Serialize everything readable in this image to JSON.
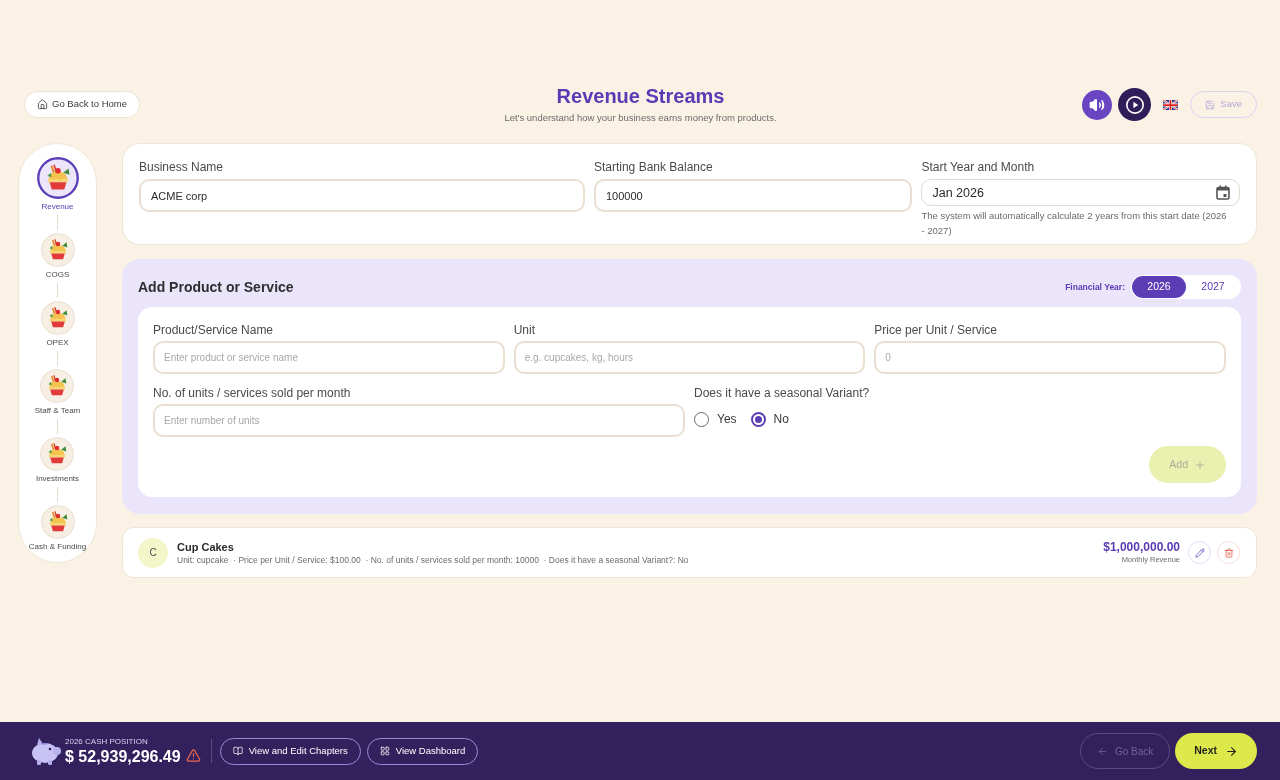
{
  "header": {
    "back_button": "Go Back to Home",
    "title": "Revenue Streams",
    "subtitle": "Let's understand how your business earns money from products.",
    "save_button": {
      "label": "Save",
      "disabled": true
    }
  },
  "steps": [
    {
      "label": "Revenue",
      "selected": true
    },
    {
      "label": "COGS",
      "selected": false
    },
    {
      "label": "OPEX",
      "selected": false
    },
    {
      "label": "Staff & Team",
      "selected": false
    },
    {
      "label": "Investments",
      "selected": false
    },
    {
      "label": "Cash & Funding",
      "selected": false
    }
  ],
  "business_details": {
    "fields": [
      {
        "kind": "text",
        "label": "Business Name",
        "value": "ACME corp"
      },
      {
        "kind": "text",
        "label": "Starting Bank Balance",
        "value": "100000"
      },
      {
        "kind": "date",
        "label": "Start Year and Month",
        "value": "Jan 2026",
        "hint": "The system will automatically calculate 2 years from this start date (2026 - 2027)"
      }
    ]
  },
  "add_product": {
    "title": "Add Product or Service",
    "financial_year_label": "Financial Year:",
    "years": [
      {
        "label": "2026",
        "selected": true
      },
      {
        "label": "2027",
        "selected": false
      }
    ],
    "fields": [
      {
        "label": "Product/Service Name",
        "placeholder": "Enter product or service name"
      },
      {
        "label": "Unit",
        "placeholder": "e.g. cupcakes, kg, hours"
      },
      {
        "label": "Price per Unit / Service",
        "placeholder": "0"
      },
      {
        "label": "No. of units / services sold per month",
        "placeholder": "Enter number of units"
      }
    ],
    "seasonal": {
      "label": "Does it have a seasonal Variant?",
      "options": [
        {
          "label": "Yes",
          "selected": false
        },
        {
          "label": "No",
          "selected": true
        }
      ]
    },
    "add_button": {
      "label": "Add",
      "disabled": true
    }
  },
  "products": [
    {
      "initial": "C",
      "name": "Cup Cakes",
      "details": "Unit: cupcake  · Price per Unit / Service: $100.00  · No. of units / services sold per month: 10000  · Does it have a seasonal Variant?: No",
      "amount": "$1,000,000.00",
      "amount_label": "Monthly Revenue"
    }
  ],
  "footer": {
    "cash_label": "2026 CASH POSITION",
    "cash_value": "$ 52,939,296.49",
    "warning": true,
    "links": [
      "View and Edit Chapters",
      "View Dashboard"
    ],
    "back_button": {
      "label": "Go Back",
      "disabled": true
    },
    "next_button": "Next"
  }
}
